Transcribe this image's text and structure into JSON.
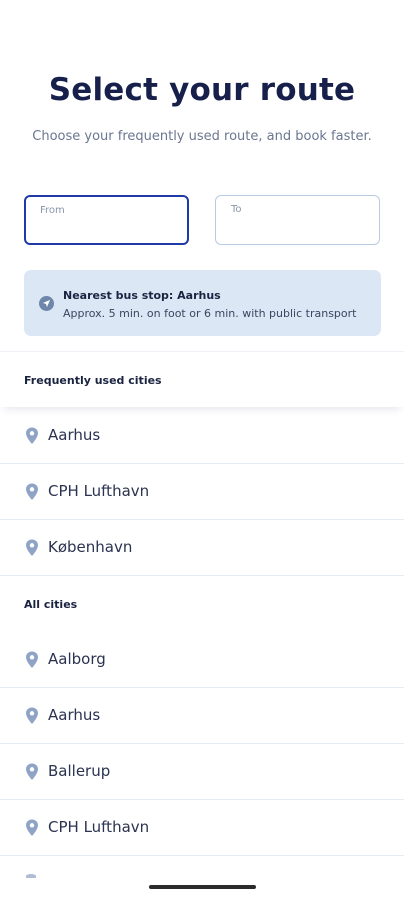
{
  "header": {
    "title": "Select your route",
    "subtitle": "Choose your frequently used route, and book faster."
  },
  "fields": {
    "from_label": "From",
    "to_label": "To"
  },
  "nearest_stop": {
    "icon": "navigation-arrow-icon",
    "title": "Nearest bus stop: Aarhus",
    "detail": "Approx. 5 min. on foot or 6 min. with public transport"
  },
  "frequent": {
    "header": "Frequently used cities",
    "items": [
      {
        "name": "Aarhus"
      },
      {
        "name": "CPH Lufthavn"
      },
      {
        "name": "København"
      }
    ]
  },
  "all": {
    "header": "All cities",
    "items": [
      {
        "name": "Aalborg"
      },
      {
        "name": "Aarhus"
      },
      {
        "name": "Ballerup"
      },
      {
        "name": "CPH Lufthavn"
      }
    ]
  },
  "colors": {
    "accent": "#1f3aa8",
    "info_bg": "#dce7f5",
    "pin": "#8fa3c4",
    "title": "#16204a"
  }
}
